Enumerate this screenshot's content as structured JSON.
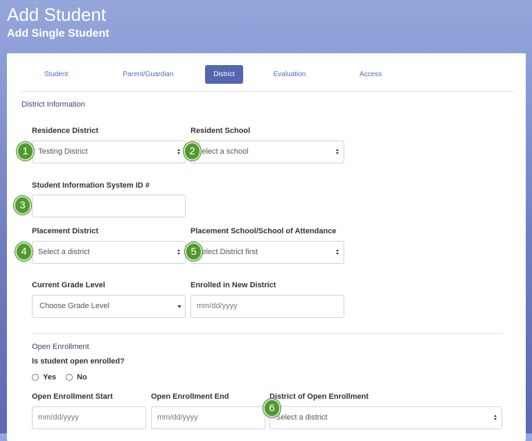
{
  "header": {
    "title": "Add Student",
    "subtitle": "Add Single Student"
  },
  "tabs": [
    {
      "label": "Student",
      "active": false
    },
    {
      "label": "Parent/Guardian",
      "active": false
    },
    {
      "label": "District",
      "active": true
    },
    {
      "label": "Evaluation",
      "active": false
    },
    {
      "label": "Access",
      "active": false
    }
  ],
  "district_info": {
    "section_title": "District Information",
    "residence_district": {
      "label": "Residence District",
      "value": "Testing District"
    },
    "resident_school": {
      "label": "Resident School",
      "value": "Select a school"
    },
    "sis_id": {
      "label": "Student Information System ID #",
      "value": ""
    },
    "placement_district": {
      "label": "Placement District",
      "value": "Select a district"
    },
    "placement_school": {
      "label": "Placement School/School of Attendance",
      "value": "Select District first"
    },
    "grade_level": {
      "label": "Current Grade Level",
      "value": "Choose Grade Level"
    },
    "enrolled_new_district": {
      "label": "Enrolled in New District",
      "placeholder": "mm/dd/yyyy"
    }
  },
  "open_enrollment": {
    "section_title": "Open Enrollment",
    "question": "Is student open enrolled?",
    "yes_label": "Yes",
    "no_label": "No",
    "start": {
      "label": "Open Enrollment Start",
      "placeholder": "mm/dd/yyyy"
    },
    "end": {
      "label": "Open Enrollment End",
      "placeholder": "mm/dd/yyyy"
    },
    "district": {
      "label": "District of Open Enrollment",
      "value": "Select a district"
    }
  },
  "callouts": [
    "1",
    "2",
    "3",
    "4",
    "5",
    "6"
  ],
  "colors": {
    "accent": "#5466ad",
    "callout": "#4f9a2e",
    "link": "#4a6fb5"
  }
}
